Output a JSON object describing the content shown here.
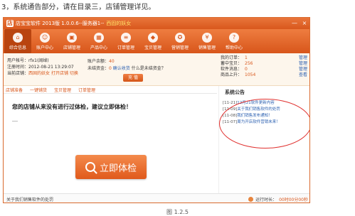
{
  "doc": {
    "caption_top": "3，系统通告部分，请在目录三，店铺管理详见。",
    "caption_bottom": "图 1.2.5"
  },
  "window": {
    "title": "店宝宝软件 2013版 1.0.0.6--服务器1--",
    "shop_name": "西固的妖女",
    "min": "—",
    "close": "×"
  },
  "toolbar": {
    "items": [
      {
        "label": "综合信息",
        "icon": "home-icon",
        "glyph": "⌂"
      },
      {
        "label": "账户中心",
        "icon": "user-icon",
        "glyph": "☺"
      },
      {
        "label": "店铺管理",
        "icon": "store-icon",
        "glyph": "▣"
      },
      {
        "label": "产品中心",
        "icon": "product-icon",
        "glyph": "▦"
      },
      {
        "label": "订单管理",
        "icon": "order-icon",
        "glyph": "≡"
      },
      {
        "label": "宝贝管理",
        "icon": "goods-icon",
        "glyph": "◆"
      },
      {
        "label": "营销管理",
        "icon": "marketing-icon",
        "glyph": "✪"
      },
      {
        "label": "销售管理",
        "icon": "sales-icon",
        "glyph": "¥"
      },
      {
        "label": "帮助中心",
        "icon": "help-icon",
        "glyph": "?"
      }
    ]
  },
  "account": {
    "user_label": "用户帐号：",
    "user_value": "rfx1(阔绰)",
    "reg_label": "注册时间：",
    "reg_value": "2012-08-21 13:29:07",
    "shop_label": "当前店铺：",
    "shop_value": "西固的妖女",
    "shop_link": "打开店铺 切换"
  },
  "balance": {
    "balance_label": "账户余额：",
    "balance_value": "40",
    "unsettled_label": "未结资金：",
    "unsettled_value": "0",
    "unsettled_link": "确认收货",
    "unsettled_q": "什么是未结资金？",
    "recharge": "充 值"
  },
  "stats": [
    {
      "label": "我的订单：",
      "value": "1",
      "action": "管理"
    },
    {
      "label": "蓄中宝贝：",
      "value": "256",
      "action": "管理"
    },
    {
      "label": "软件消息：",
      "value": "0",
      "action": "管理"
    },
    {
      "label": "商品上升：",
      "value": "1054",
      "action": "查看"
    }
  ],
  "linkbar": [
    "店铺准备",
    "一键铺货",
    "宝贝管理",
    "订单管理"
  ],
  "main": {
    "warning": "您的店铺从来没有进行过体检，建议立即体检！",
    "check_button": "立即体检"
  },
  "notice": {
    "title": "系统公告",
    "items": [
      {
        "date": "[11-21]",
        "text": "12月21软件更新内容"
      },
      {
        "date": "[11-09]",
        "text": "关于我们销售软件的处罚"
      },
      {
        "date": "[11-08]",
        "text": "我们销售发布通知！"
      },
      {
        "date": "[11-07]",
        "text": "周为开店软件营销未来！"
      }
    ]
  },
  "status": {
    "left": "关于我们销售软件的处罚",
    "right_label": "运行时长：",
    "right_value": "00时00分00秒"
  }
}
